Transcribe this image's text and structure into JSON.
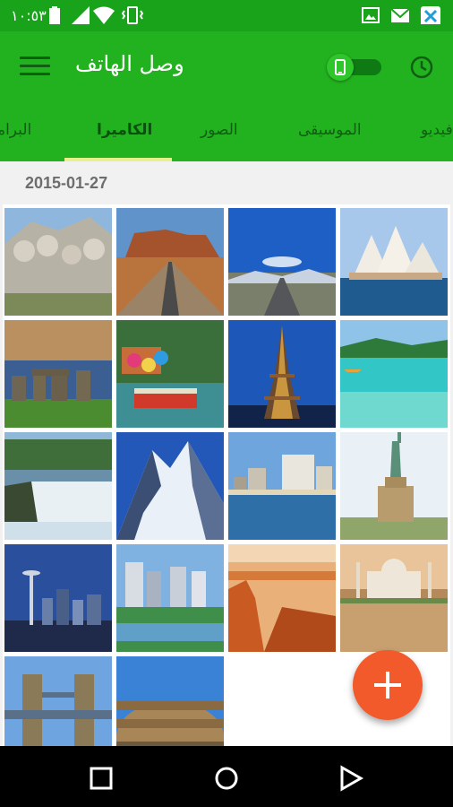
{
  "status_bar": {
    "time": "١٠:٥٣",
    "icons": [
      "battery-icon",
      "signal-icon",
      "wifi-icon",
      "vibrate-icon",
      "image-notification-icon",
      "gmail-icon",
      "app-notification-icon"
    ]
  },
  "app_bar": {
    "title": "وصل الهاتف",
    "menu_icon": "hamburger-menu-icon",
    "toggle_icon": "phone-icon",
    "history_icon": "clock-icon"
  },
  "tabs": {
    "items": [
      {
        "label": "فيديو"
      },
      {
        "label": "الموسيقى"
      },
      {
        "label": "الصور"
      },
      {
        "label": "الكاميرا"
      },
      {
        "label": "البرامج"
      }
    ],
    "active_index": 3
  },
  "gallery": {
    "date": "2015-01-27",
    "photos": [
      {
        "name": "mount-rushmore"
      },
      {
        "name": "desert-road"
      },
      {
        "name": "mountain-road"
      },
      {
        "name": "sydney-opera-house"
      },
      {
        "name": "stonehenge"
      },
      {
        "name": "river-walk"
      },
      {
        "name": "eiffel-tower"
      },
      {
        "name": "kayak-lagoon"
      },
      {
        "name": "niagara-falls"
      },
      {
        "name": "snowy-mountain"
      },
      {
        "name": "city-harbor"
      },
      {
        "name": "statue-of-liberty"
      },
      {
        "name": "seattle-skyline"
      },
      {
        "name": "palm-city"
      },
      {
        "name": "canyon"
      },
      {
        "name": "taj-mahal"
      },
      {
        "name": "tower-bridge"
      },
      {
        "name": "colosseum"
      }
    ]
  },
  "fab": {
    "icon": "plus-icon"
  },
  "nav_bar": {
    "icons": [
      "recents-square-icon",
      "home-circle-icon",
      "back-triangle-icon"
    ]
  },
  "colors": {
    "primary": "#22b21f",
    "status_bar": "#18a31a",
    "tab_indicator": "#e7f28f",
    "accent": "#f25a2b"
  }
}
